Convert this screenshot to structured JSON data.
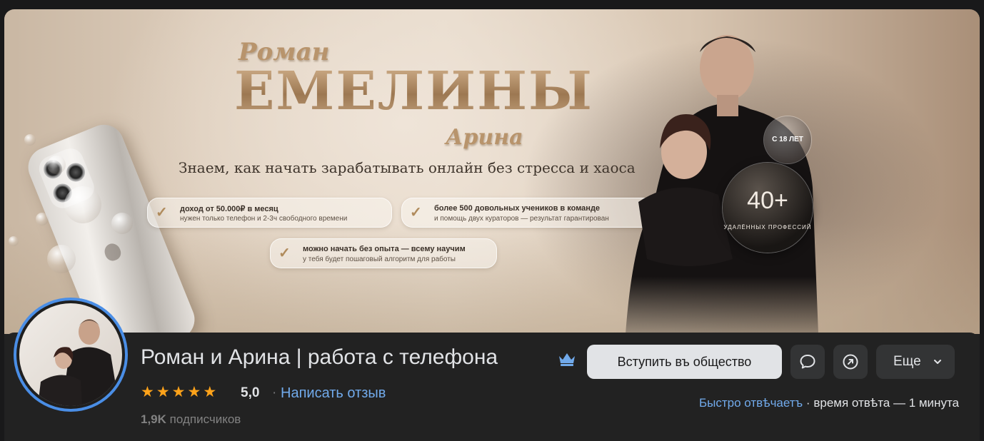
{
  "cover": {
    "title_top": "Роман",
    "title_main": "ЕМЕЛИНЫ",
    "title_bottom": "Арина",
    "tagline": "Знаем, как начать зарабатывать онлайн без стресса и хаоса",
    "pills": [
      {
        "line1": "доход от 50.000₽ в месяц",
        "line2": "нужен только телефон и 2-3ч свободного времени"
      },
      {
        "line1": "более 500 довольных учеников в команде",
        "line2": "и помощь двух кураторов — результат гарантирован"
      },
      {
        "line1": "можно начать без опыта — всему научим",
        "line2": "у тебя будет пошаговый алгоритм для работы"
      }
    ],
    "badge_age": "С 18 ЛЕТ",
    "badge_count": "40+",
    "badge_count_caption": "УДАЛЁННЫХ ПРОФЕССИЙ"
  },
  "group": {
    "name": "Роман и Арина | работа с телефона",
    "rating": "5,0",
    "stars": 5,
    "separator": "·",
    "review_link": "Написать отзыв",
    "subscribers_count": "1,9K",
    "subscribers_label": "подписчиков"
  },
  "actions": {
    "join": "Вступить въ общество",
    "more": "Еще"
  },
  "response": {
    "fast": "Быстро отвѣчаетъ",
    "separator": "·",
    "time": "время отвѣта — 1 минута"
  },
  "colors": {
    "background": "#19191a",
    "panel": "#222222",
    "accent_link": "#71aaeb",
    "star": "#ffa31a",
    "avatar_ring": "#4a8ee6",
    "primary_button": "#e1e3e6",
    "secondary_button": "#333435"
  },
  "icons": {
    "crown": "crown-icon",
    "message": "message-icon",
    "share": "share-icon",
    "chevron": "chevron-down-icon",
    "check": "check-icon",
    "star": "star-icon"
  }
}
